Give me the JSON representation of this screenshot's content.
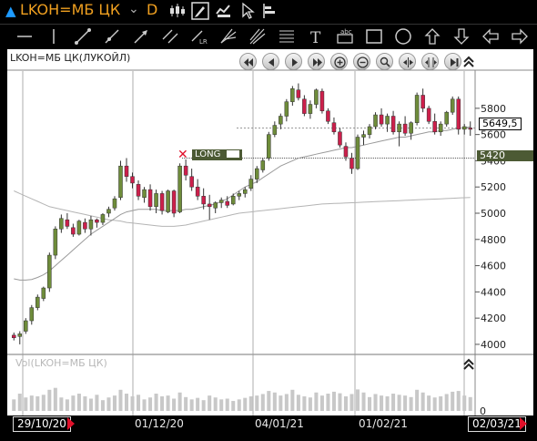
{
  "title": {
    "symbol": "LKOH=МБ ЦК",
    "timeframe": "D",
    "chevron": "⌄"
  },
  "chart": {
    "symbol_label": "LKOH=МБ ЦК(ЛУКОЙЛ)",
    "volume_label": "Vol(LKOH=МБ ЦК)",
    "last_price": "5649,5",
    "position_price": "5420",
    "position_label": "LONG",
    "volume_zero": "0",
    "start_date": "29/10/20",
    "end_date": "02/03/21",
    "date_labels": [
      "01/12/20",
      "04/01/21",
      "01/02/21"
    ]
  },
  "chart_data": {
    "type": "candlestick",
    "y_ticks": [
      "4000",
      "4200",
      "4400",
      "4600",
      "4800",
      "5000",
      "5200",
      "5400",
      "5600",
      "5800"
    ],
    "ylim": [
      3930,
      6070
    ],
    "candles": [
      [
        4070,
        4090,
        4030,
        4050
      ],
      [
        4060,
        4100,
        4000,
        4080
      ],
      [
        4100,
        4200,
        4080,
        4180
      ],
      [
        4180,
        4300,
        4150,
        4280
      ],
      [
        4280,
        4380,
        4260,
        4360
      ],
      [
        4350,
        4440,
        4330,
        4430
      ],
      [
        4430,
        4700,
        4400,
        4680
      ],
      [
        4680,
        4900,
        4650,
        4880
      ],
      [
        4880,
        4990,
        4850,
        4960
      ],
      [
        4950,
        5000,
        4880,
        4900
      ],
      [
        4890,
        4920,
        4820,
        4840
      ],
      [
        4840,
        4950,
        4830,
        4940
      ],
      [
        4930,
        4960,
        4850,
        4880
      ],
      [
        4880,
        4980,
        4830,
        4950
      ],
      [
        4950,
        4960,
        4890,
        4930
      ],
      [
        4930,
        5000,
        4910,
        4990
      ],
      [
        5000,
        5050,
        4970,
        5030
      ],
      [
        5040,
        5130,
        5020,
        5110
      ],
      [
        5120,
        5400,
        5100,
        5360
      ],
      [
        5360,
        5420,
        5240,
        5280
      ],
      [
        5280,
        5310,
        5190,
        5230
      ],
      [
        5220,
        5250,
        5100,
        5130
      ],
      [
        5120,
        5200,
        5080,
        5180
      ],
      [
        5180,
        5220,
        5020,
        5050
      ],
      [
        5050,
        5180,
        5000,
        5150
      ],
      [
        5150,
        5170,
        4990,
        5020
      ],
      [
        5010,
        5180,
        5000,
        5170
      ],
      [
        5170,
        5180,
        4970,
        5000
      ],
      [
        5010,
        5380,
        5000,
        5360
      ],
      [
        5360,
        5410,
        5250,
        5290
      ],
      [
        5280,
        5340,
        5170,
        5200
      ],
      [
        5200,
        5260,
        5100,
        5130
      ],
      [
        5130,
        5190,
        5030,
        5070
      ],
      [
        5070,
        5140,
        4950,
        5050
      ],
      [
        5040,
        5090,
        5000,
        5080
      ],
      [
        5080,
        5120,
        5040,
        5100
      ],
      [
        5090,
        5130,
        5040,
        5060
      ],
      [
        5070,
        5150,
        5060,
        5130
      ],
      [
        5130,
        5170,
        5100,
        5150
      ],
      [
        5150,
        5200,
        5120,
        5180
      ],
      [
        5190,
        5290,
        5170,
        5260
      ],
      [
        5260,
        5360,
        5230,
        5340
      ],
      [
        5330,
        5420,
        5310,
        5400
      ],
      [
        5420,
        5620,
        5400,
        5600
      ],
      [
        5600,
        5700,
        5580,
        5670
      ],
      [
        5680,
        5760,
        5640,
        5740
      ],
      [
        5740,
        5870,
        5700,
        5850
      ],
      [
        5850,
        5970,
        5820,
        5950
      ],
      [
        5940,
        5990,
        5860,
        5880
      ],
      [
        5870,
        5900,
        5740,
        5760
      ],
      [
        5760,
        5860,
        5720,
        5830
      ],
      [
        5830,
        5950,
        5800,
        5940
      ],
      [
        5930,
        5950,
        5760,
        5780
      ],
      [
        5780,
        5800,
        5680,
        5700
      ],
      [
        5690,
        5730,
        5600,
        5620
      ],
      [
        5620,
        5650,
        5500,
        5520
      ],
      [
        5510,
        5540,
        5400,
        5430
      ],
      [
        5420,
        5460,
        5300,
        5340
      ],
      [
        5340,
        5600,
        5330,
        5580
      ],
      [
        5580,
        5630,
        5520,
        5600
      ],
      [
        5600,
        5680,
        5570,
        5660
      ],
      [
        5660,
        5770,
        5640,
        5750
      ],
      [
        5750,
        5800,
        5660,
        5680
      ],
      [
        5680,
        5760,
        5620,
        5740
      ],
      [
        5740,
        5780,
        5600,
        5620
      ],
      [
        5620,
        5700,
        5510,
        5680
      ],
      [
        5680,
        5740,
        5590,
        5610
      ],
      [
        5610,
        5700,
        5560,
        5690
      ],
      [
        5690,
        5920,
        5670,
        5900
      ],
      [
        5900,
        5950,
        5770,
        5800
      ],
      [
        5800,
        5820,
        5680,
        5700
      ],
      [
        5700,
        5760,
        5600,
        5620
      ],
      [
        5620,
        5700,
        5590,
        5680
      ],
      [
        5680,
        5780,
        5660,
        5770
      ],
      [
        5770,
        5890,
        5750,
        5870
      ],
      [
        5870,
        5890,
        5600,
        5640
      ],
      [
        5640,
        5680,
        5600,
        5660
      ],
      [
        5650,
        5700,
        5590,
        5640
      ]
    ],
    "ma_fast": [
      4500,
      4490,
      4490,
      4495,
      4510,
      4530,
      4560,
      4600,
      4640,
      4680,
      4720,
      4760,
      4800,
      4840,
      4870,
      4900,
      4930,
      4960,
      4990,
      5010,
      5020,
      5030,
      5030,
      5030,
      5030,
      5020,
      5020,
      5020,
      5020,
      5030,
      5030,
      5040,
      5050,
      5060,
      5070,
      5090,
      5110,
      5140,
      5170,
      5200,
      5220,
      5240,
      5270,
      5300,
      5330,
      5360,
      5380,
      5400,
      5420,
      5430,
      5440,
      5450,
      5460,
      5470,
      5480,
      5490,
      5500,
      5500,
      5510,
      5520,
      5530,
      5540,
      5550,
      5560,
      5570,
      5580,
      5580,
      5590,
      5600,
      5610,
      5620,
      5620,
      5630,
      5630,
      5640,
      5650,
      5650,
      5660
    ],
    "ma_slow": [
      5170,
      5150,
      5130,
      5110,
      5090,
      5070,
      5050,
      5040,
      5030,
      5020,
      5010,
      5000,
      4990,
      4980,
      4970,
      4960,
      4950,
      4945,
      4940,
      4930,
      4925,
      4920,
      4915,
      4910,
      4905,
      4900,
      4900,
      4900,
      4905,
      4910,
      4920,
      4930,
      4940,
      4950,
      4960,
      4970,
      4980,
      4990,
      5000,
      5005,
      5010,
      5015,
      5020,
      5025,
      5030,
      5035,
      5040,
      5045,
      5050,
      5055,
      5060,
      5065,
      5070,
      5072,
      5074,
      5076,
      5078,
      5080,
      5082,
      5084,
      5086,
      5088,
      5090,
      5092,
      5094,
      5096,
      5098,
      5100,
      5102,
      5104,
      5106,
      5108,
      5110,
      5112,
      5114,
      5116,
      5118,
      5120
    ],
    "volume": [
      30,
      45,
      35,
      40,
      38,
      42,
      55,
      60,
      35,
      30,
      40,
      45,
      38,
      32,
      42,
      28,
      35,
      40,
      55,
      45,
      38,
      42,
      30,
      35,
      45,
      38,
      40,
      32,
      48,
      36,
      30,
      34,
      28,
      40,
      35,
      30,
      32,
      26,
      30,
      34,
      38,
      40,
      44,
      52,
      48,
      40,
      44,
      55,
      42,
      38,
      35,
      48,
      40,
      45,
      50,
      46,
      38,
      44,
      56,
      48,
      36,
      44,
      40,
      38,
      45,
      42,
      40,
      36,
      55,
      48,
      40,
      35,
      38,
      44,
      50,
      52,
      40,
      36
    ]
  },
  "colors": {
    "bull": "#6e8c3a",
    "bear": "#cc1f4b",
    "accent": "#f0a020",
    "position": "#4c5a34",
    "ma_fast": "#9a9a9a",
    "ma_slow": "#b4b4b4"
  }
}
